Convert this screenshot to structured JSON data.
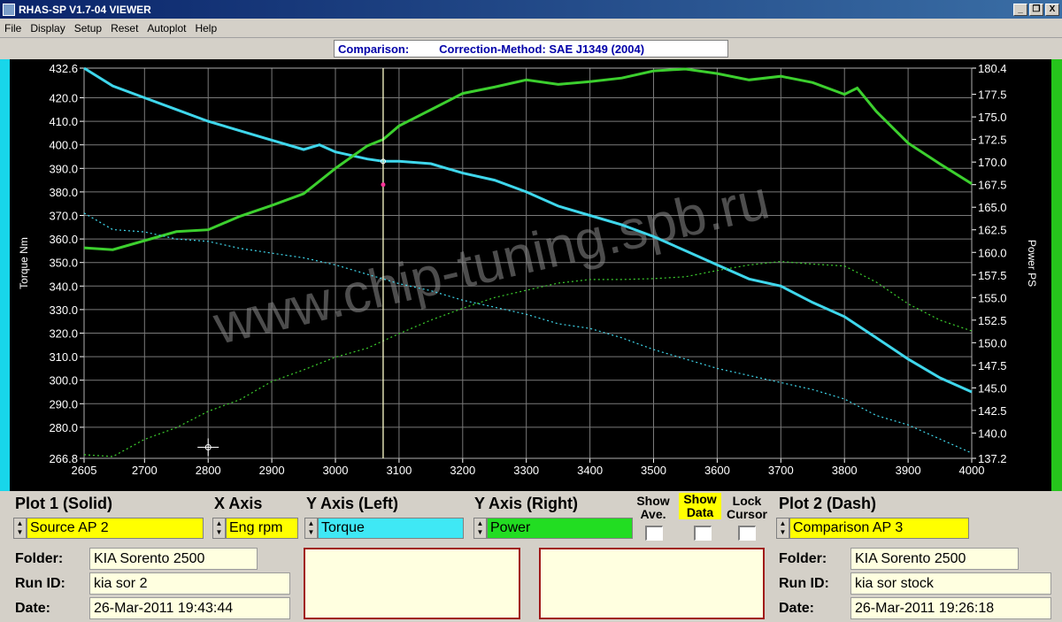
{
  "window": {
    "title": "RHAS-SP V1.7-04  VIEWER",
    "buttons": [
      "_",
      "❐",
      "X"
    ]
  },
  "menu": [
    "File",
    "Display",
    "Setup",
    "Reset",
    "Autoplot",
    "Help"
  ],
  "comparison": {
    "label": "Comparison:",
    "method": "Correction-Method: SAE J1349 (2004)"
  },
  "watermark": "www.chip-tuning.spb.ru",
  "chart_data": {
    "type": "line",
    "xlabel": "",
    "ylabel_left": "Torque Nm",
    "ylabel_right": "Power PS",
    "xlim": [
      2605,
      4000
    ],
    "ylim_left": [
      266.8,
      432.6
    ],
    "ylim_right": [
      137.2,
      180.4
    ],
    "x_ticks": [
      "2605",
      "2700",
      "2800",
      "2900",
      "3000",
      "3100",
      "3200",
      "3300",
      "3400",
      "3500",
      "3600",
      "3700",
      "3800",
      "3900",
      "4000"
    ],
    "left_ticks": [
      "432.6",
      "420.0",
      "410.0",
      "400.0",
      "390.0",
      "380.0",
      "370.0",
      "360.0",
      "350.0",
      "340.0",
      "330.0",
      "320.0",
      "310.0",
      "300.0",
      "290.0",
      "280.0",
      "266.8"
    ],
    "right_ticks": [
      "180.4",
      "177.5",
      "175.0",
      "172.5",
      "170.0",
      "167.5",
      "165.0",
      "162.5",
      "160.0",
      "157.5",
      "155.0",
      "152.5",
      "150.0",
      "147.5",
      "145.0",
      "142.5",
      "140.0",
      "137.2"
    ],
    "grid": true,
    "cursor_x": 3075,
    "colors": {
      "torque": "#3fd7ec",
      "power": "#3ccf2e",
      "background": "#000000"
    },
    "series": [
      {
        "name": "Torque",
        "axis": "left",
        "style": "solid",
        "x": [
          2605,
          2650,
          2700,
          2750,
          2800,
          2850,
          2900,
          2950,
          2975,
          3000,
          3050,
          3075,
          3100,
          3150,
          3200,
          3250,
          3300,
          3350,
          3400,
          3450,
          3500,
          3550,
          3600,
          3650,
          3700,
          3750,
          3800,
          3850,
          3900,
          3950,
          4000
        ],
        "y": [
          432.6,
          425,
          420,
          415,
          410,
          406,
          402,
          398,
          400,
          397,
          394,
          393,
          393,
          392,
          388,
          385,
          380,
          374,
          370,
          366,
          361,
          355,
          349,
          343,
          340,
          333,
          327,
          318,
          309,
          301,
          295
        ]
      },
      {
        "name": "Power",
        "axis": "right",
        "style": "solid",
        "x": [
          2605,
          2650,
          2700,
          2750,
          2800,
          2850,
          2900,
          2950,
          3000,
          3050,
          3075,
          3100,
          3150,
          3200,
          3250,
          3300,
          3350,
          3400,
          3450,
          3500,
          3550,
          3600,
          3650,
          3700,
          3750,
          3800,
          3820,
          3850,
          3900,
          3950,
          4000
        ],
        "y": [
          160.5,
          160.3,
          161.3,
          162.3,
          162.5,
          164,
          165.2,
          166.5,
          169.3,
          171.8,
          172.5,
          174,
          175.8,
          177.6,
          178.3,
          179.1,
          178.6,
          178.9,
          179.3,
          180.1,
          180.3,
          179.8,
          179.1,
          179.5,
          178.8,
          177.5,
          178.2,
          175.6,
          172.1,
          169.8,
          167.6
        ]
      },
      {
        "name": "Torque",
        "axis": "left",
        "style": "dashed",
        "x": [
          2605,
          2650,
          2700,
          2750,
          2800,
          2850,
          2900,
          2950,
          3000,
          3050,
          3100,
          3150,
          3200,
          3250,
          3300,
          3350,
          3400,
          3450,
          3500,
          3550,
          3600,
          3650,
          3700,
          3750,
          3800,
          3850,
          3900,
          3950,
          4000
        ],
        "y": [
          371,
          364,
          363,
          360,
          359,
          356,
          354,
          352,
          349,
          345,
          341,
          338,
          334,
          331,
          328,
          324,
          322,
          318,
          313,
          309,
          305,
          302,
          299,
          296,
          292,
          285,
          281,
          275,
          269
        ]
      },
      {
        "name": "Power",
        "axis": "right",
        "style": "dashed",
        "x": [
          2605,
          2650,
          2700,
          2750,
          2800,
          2850,
          2900,
          2950,
          3000,
          3050,
          3100,
          3150,
          3200,
          3250,
          3300,
          3350,
          3400,
          3450,
          3500,
          3550,
          3600,
          3650,
          3700,
          3750,
          3800,
          3850,
          3900,
          3950,
          4000
        ],
        "y": [
          137.6,
          137.4,
          139.3,
          140.6,
          142.4,
          143.7,
          145.7,
          147,
          148.4,
          149.4,
          151,
          152.5,
          153.8,
          155,
          155.8,
          156.6,
          157,
          157,
          157.1,
          157.3,
          158,
          158.6,
          159,
          158.7,
          158.5,
          156.7,
          154.3,
          152.5,
          151.3
        ]
      }
    ]
  },
  "controls": {
    "plot1_header": "Plot 1 (Solid)",
    "xaxis_header": "X Axis",
    "yleft_header": "Y Axis (Left)",
    "yright_header": "Y Axis (Right)",
    "plot2_header": "Plot 2 (Dash)",
    "plot1_source": "Source AP 2",
    "xaxis_value": "Eng rpm",
    "yleft_value": "Torque",
    "yright_value": "Power",
    "plot2_source": "Comparison AP 3",
    "show_ave": "Show\nAve.",
    "show_data": "Show\nData",
    "lock_cursor": "Lock\nCursor",
    "colors": {
      "source": "#ffff00",
      "yleft": "#3fe8f5",
      "yright": "#22dd22"
    }
  },
  "plot1_info": {
    "folder_label": "Folder:",
    "folder": "KIA Sorento 2500",
    "run_label": "Run ID:",
    "run": "kia sor 2",
    "date_label": "Date:",
    "date": "26-Mar-2011  19:43:44"
  },
  "plot2_info": {
    "folder_label": "Folder:",
    "folder": "KIA Sorento 2500",
    "run_label": "Run ID:",
    "run": "kia sor stock",
    "date_label": "Date:",
    "date": "26-Mar-2011  19:26:18"
  }
}
